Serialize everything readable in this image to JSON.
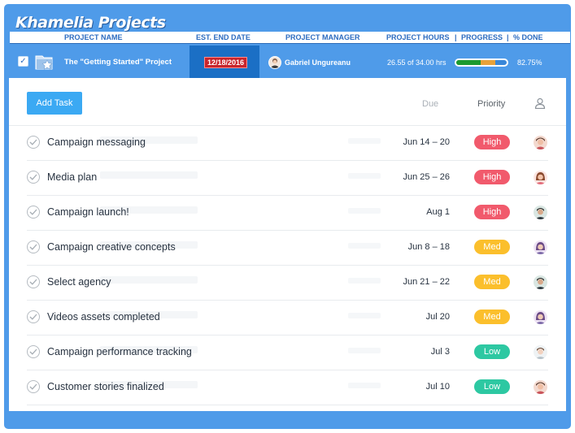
{
  "app": {
    "title": "Khamelia Projects"
  },
  "columns": {
    "name": "PROJECT NAME",
    "end_date": "EST. END DATE",
    "manager": "PROJECT MANAGER",
    "hours": "PROJECT HOURS",
    "progress": "PROGRESS",
    "done": "% DONE",
    "sep": "|"
  },
  "project": {
    "name": "The \"Getting Started\" Project",
    "end_date": "12/18/2016",
    "manager": "Gabriel Ungureanu",
    "hours": "26.55 of 34.00 hrs",
    "progress": 0.78,
    "percent_done": "82.75%",
    "checked": true
  },
  "toolbar": {
    "add_task_label": "Add Task"
  },
  "table_header": {
    "due": "Due",
    "priority": "Priority",
    "assignee_icon": "person-icon"
  },
  "colors": {
    "frame": "#4f9be9",
    "add_task": "#3ba9f3",
    "high": "#f15a6c",
    "med": "#fbbf2c",
    "low": "#2dc8a2",
    "date_badge": "#c9252c"
  },
  "tasks": [
    {
      "name": "Campaign messaging",
      "due": "Jun 14 – 20",
      "priority": "High",
      "level": "high",
      "avatar": "avatar-1"
    },
    {
      "name": "Media plan",
      "due": "Jun 25 – 26",
      "priority": "High",
      "level": "high",
      "avatar": "avatar-2"
    },
    {
      "name": "Campaign launch!",
      "due": "Aug 1",
      "priority": "High",
      "level": "high",
      "avatar": "avatar-3"
    },
    {
      "name": "Campaign creative concepts",
      "due": "Jun 8 – 18",
      "priority": "Med",
      "level": "med",
      "avatar": "avatar-4"
    },
    {
      "name": "Select agency",
      "due": "Jun 21 – 22",
      "priority": "Med",
      "level": "med",
      "avatar": "avatar-3"
    },
    {
      "name": "Videos assets completed",
      "due": "Jul 20",
      "priority": "Med",
      "level": "med",
      "avatar": "avatar-4"
    },
    {
      "name": "Campaign performance tracking",
      "due": "Jul 3",
      "priority": "Low",
      "level": "low",
      "avatar": "avatar-5"
    },
    {
      "name": "Customer stories finalized",
      "due": "Jul 10",
      "priority": "Low",
      "level": "low",
      "avatar": "avatar-1"
    }
  ]
}
